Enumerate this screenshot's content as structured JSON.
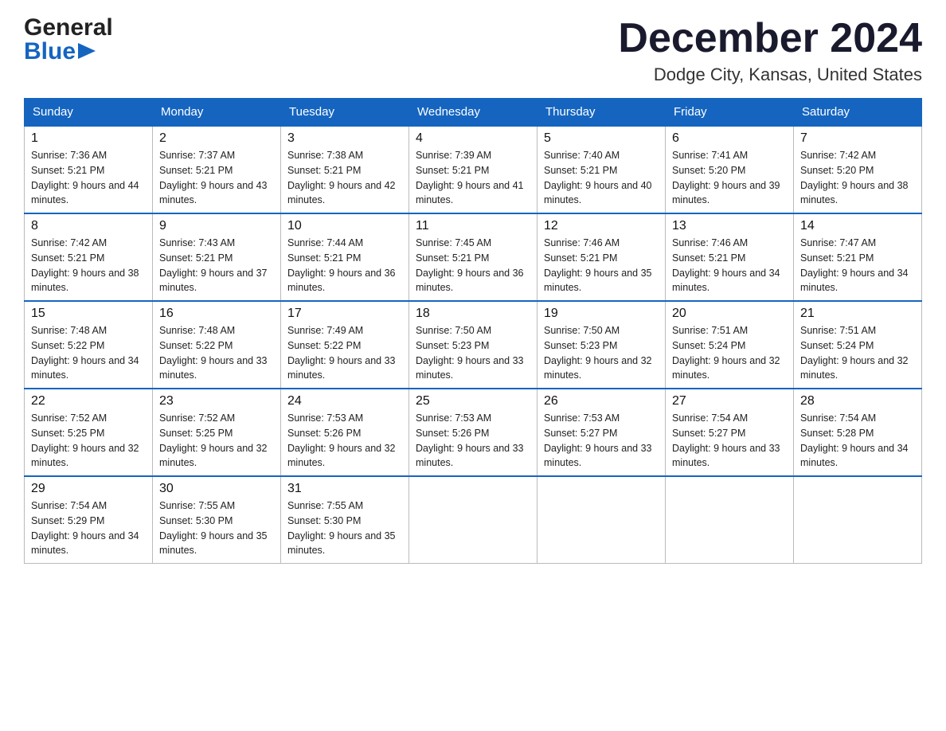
{
  "header": {
    "logo": {
      "line1": "General",
      "line2": "Blue"
    },
    "title": "December 2024",
    "location": "Dodge City, Kansas, United States"
  },
  "calendar": {
    "days_of_week": [
      "Sunday",
      "Monday",
      "Tuesday",
      "Wednesday",
      "Thursday",
      "Friday",
      "Saturday"
    ],
    "weeks": [
      [
        {
          "day": "1",
          "sunrise": "7:36 AM",
          "sunset": "5:21 PM",
          "daylight": "9 hours and 44 minutes."
        },
        {
          "day": "2",
          "sunrise": "7:37 AM",
          "sunset": "5:21 PM",
          "daylight": "9 hours and 43 minutes."
        },
        {
          "day": "3",
          "sunrise": "7:38 AM",
          "sunset": "5:21 PM",
          "daylight": "9 hours and 42 minutes."
        },
        {
          "day": "4",
          "sunrise": "7:39 AM",
          "sunset": "5:21 PM",
          "daylight": "9 hours and 41 minutes."
        },
        {
          "day": "5",
          "sunrise": "7:40 AM",
          "sunset": "5:21 PM",
          "daylight": "9 hours and 40 minutes."
        },
        {
          "day": "6",
          "sunrise": "7:41 AM",
          "sunset": "5:20 PM",
          "daylight": "9 hours and 39 minutes."
        },
        {
          "day": "7",
          "sunrise": "7:42 AM",
          "sunset": "5:20 PM",
          "daylight": "9 hours and 38 minutes."
        }
      ],
      [
        {
          "day": "8",
          "sunrise": "7:42 AM",
          "sunset": "5:21 PM",
          "daylight": "9 hours and 38 minutes."
        },
        {
          "day": "9",
          "sunrise": "7:43 AM",
          "sunset": "5:21 PM",
          "daylight": "9 hours and 37 minutes."
        },
        {
          "day": "10",
          "sunrise": "7:44 AM",
          "sunset": "5:21 PM",
          "daylight": "9 hours and 36 minutes."
        },
        {
          "day": "11",
          "sunrise": "7:45 AM",
          "sunset": "5:21 PM",
          "daylight": "9 hours and 36 minutes."
        },
        {
          "day": "12",
          "sunrise": "7:46 AM",
          "sunset": "5:21 PM",
          "daylight": "9 hours and 35 minutes."
        },
        {
          "day": "13",
          "sunrise": "7:46 AM",
          "sunset": "5:21 PM",
          "daylight": "9 hours and 34 minutes."
        },
        {
          "day": "14",
          "sunrise": "7:47 AM",
          "sunset": "5:21 PM",
          "daylight": "9 hours and 34 minutes."
        }
      ],
      [
        {
          "day": "15",
          "sunrise": "7:48 AM",
          "sunset": "5:22 PM",
          "daylight": "9 hours and 34 minutes."
        },
        {
          "day": "16",
          "sunrise": "7:48 AM",
          "sunset": "5:22 PM",
          "daylight": "9 hours and 33 minutes."
        },
        {
          "day": "17",
          "sunrise": "7:49 AM",
          "sunset": "5:22 PM",
          "daylight": "9 hours and 33 minutes."
        },
        {
          "day": "18",
          "sunrise": "7:50 AM",
          "sunset": "5:23 PM",
          "daylight": "9 hours and 33 minutes."
        },
        {
          "day": "19",
          "sunrise": "7:50 AM",
          "sunset": "5:23 PM",
          "daylight": "9 hours and 32 minutes."
        },
        {
          "day": "20",
          "sunrise": "7:51 AM",
          "sunset": "5:24 PM",
          "daylight": "9 hours and 32 minutes."
        },
        {
          "day": "21",
          "sunrise": "7:51 AM",
          "sunset": "5:24 PM",
          "daylight": "9 hours and 32 minutes."
        }
      ],
      [
        {
          "day": "22",
          "sunrise": "7:52 AM",
          "sunset": "5:25 PM",
          "daylight": "9 hours and 32 minutes."
        },
        {
          "day": "23",
          "sunrise": "7:52 AM",
          "sunset": "5:25 PM",
          "daylight": "9 hours and 32 minutes."
        },
        {
          "day": "24",
          "sunrise": "7:53 AM",
          "sunset": "5:26 PM",
          "daylight": "9 hours and 32 minutes."
        },
        {
          "day": "25",
          "sunrise": "7:53 AM",
          "sunset": "5:26 PM",
          "daylight": "9 hours and 33 minutes."
        },
        {
          "day": "26",
          "sunrise": "7:53 AM",
          "sunset": "5:27 PM",
          "daylight": "9 hours and 33 minutes."
        },
        {
          "day": "27",
          "sunrise": "7:54 AM",
          "sunset": "5:27 PM",
          "daylight": "9 hours and 33 minutes."
        },
        {
          "day": "28",
          "sunrise": "7:54 AM",
          "sunset": "5:28 PM",
          "daylight": "9 hours and 34 minutes."
        }
      ],
      [
        {
          "day": "29",
          "sunrise": "7:54 AM",
          "sunset": "5:29 PM",
          "daylight": "9 hours and 34 minutes."
        },
        {
          "day": "30",
          "sunrise": "7:55 AM",
          "sunset": "5:30 PM",
          "daylight": "9 hours and 35 minutes."
        },
        {
          "day": "31",
          "sunrise": "7:55 AM",
          "sunset": "5:30 PM",
          "daylight": "9 hours and 35 minutes."
        },
        null,
        null,
        null,
        null
      ]
    ]
  }
}
